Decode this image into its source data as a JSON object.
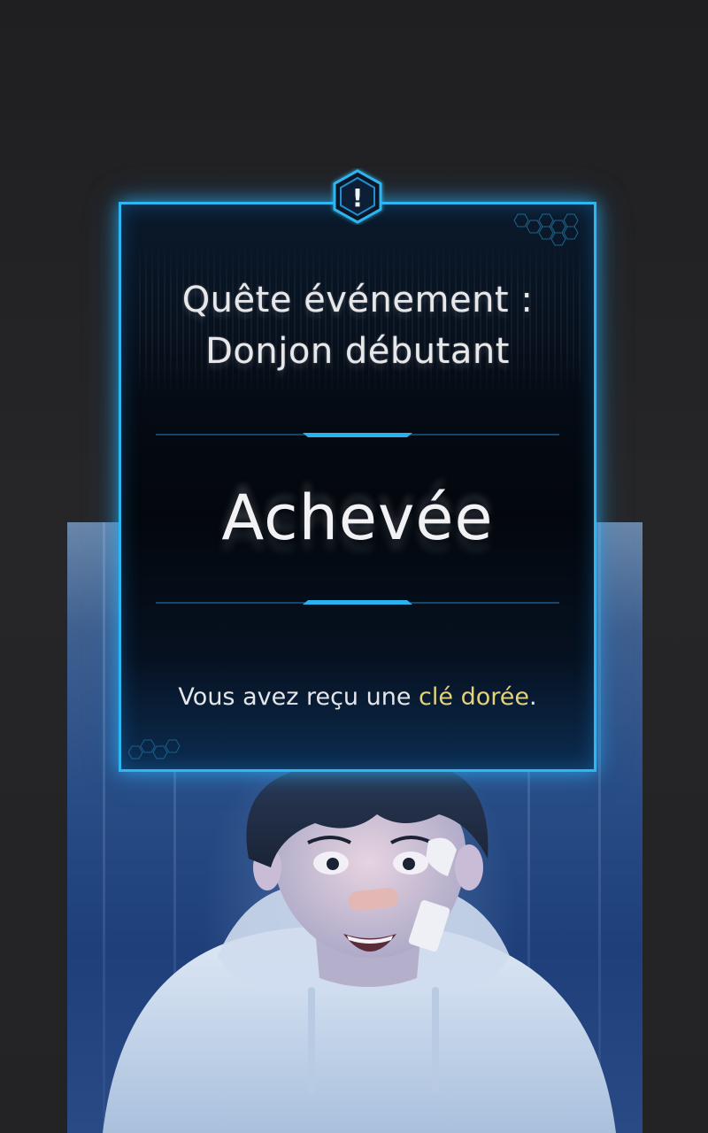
{
  "quest": {
    "title_line1": "Quête événement :",
    "title_line2": "Donjon débutant",
    "status": "Achevée",
    "reward_prefix": "Vous avez reçu une ",
    "reward_item": "clé dorée",
    "reward_suffix": "."
  },
  "alert": {
    "icon": "exclamation-hexagon-icon",
    "glyph": "!"
  },
  "colors": {
    "frame": "#2db6f0",
    "highlight": "#e3d27a",
    "text": "#e8e8ea",
    "background": "#222224"
  }
}
